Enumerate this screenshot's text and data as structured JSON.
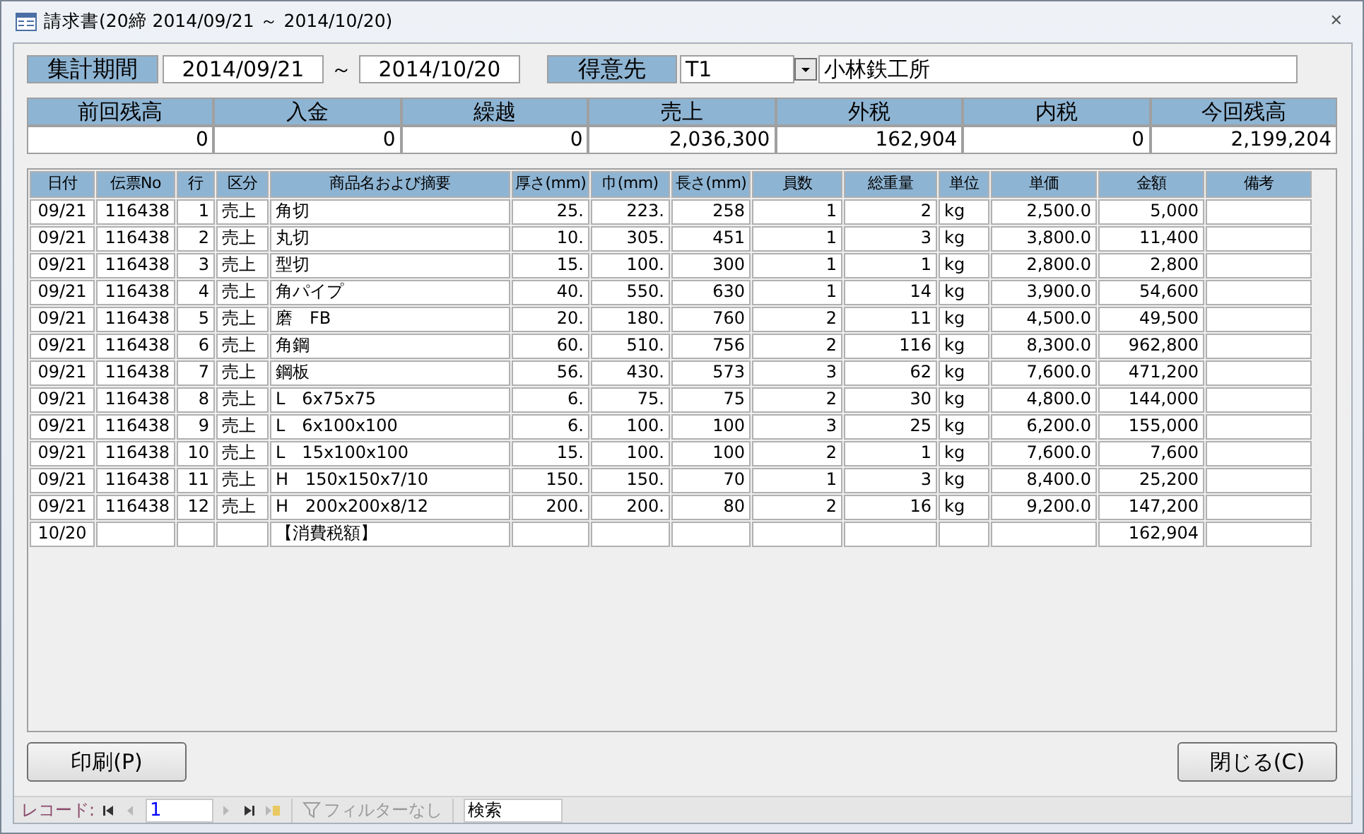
{
  "window": {
    "title": "請求書(20締 2014/09/21 ～ 2014/10/20)",
    "close": "✕"
  },
  "period": {
    "label": "集計期間",
    "from": "2014/09/21",
    "tilde": "～",
    "to": "2014/10/20"
  },
  "customer": {
    "label": "得意先",
    "code": "T1",
    "name": "小林鉄工所"
  },
  "summary": [
    {
      "label": "前回残高",
      "value": "0"
    },
    {
      "label": "入金",
      "value": "0"
    },
    {
      "label": "繰越",
      "value": "0"
    },
    {
      "label": "売上",
      "value": "2,036,300"
    },
    {
      "label": "外税",
      "value": "162,904"
    },
    {
      "label": "内税",
      "value": "0"
    },
    {
      "label": "今回残高",
      "value": "2,199,204"
    }
  ],
  "table": {
    "columns": [
      {
        "label": "日付",
        "kind": "text"
      },
      {
        "label": "伝票No",
        "kind": "number"
      },
      {
        "label": "行",
        "kind": "number"
      },
      {
        "label": "区分",
        "kind": "text"
      },
      {
        "label": "商品名および摘要",
        "kind": "text"
      },
      {
        "label": "厚さ(mm)",
        "kind": "number"
      },
      {
        "label": "巾(mm)",
        "kind": "number"
      },
      {
        "label": "長さ(mm)",
        "kind": "number"
      },
      {
        "label": "員数",
        "kind": "number"
      },
      {
        "label": "総重量",
        "kind": "number"
      },
      {
        "label": "単位",
        "kind": "text"
      },
      {
        "label": "単価",
        "kind": "number"
      },
      {
        "label": "金額",
        "kind": "number"
      },
      {
        "label": "備考",
        "kind": "text"
      }
    ],
    "rows": [
      [
        "09/21",
        "116438",
        "1",
        "売上",
        "角切",
        "25.",
        "223.",
        "258",
        "1",
        "2",
        "kg",
        "2,500.0",
        "5,000",
        null
      ],
      [
        "09/21",
        "116438",
        "2",
        "売上",
        "丸切",
        "10.",
        "305.",
        "451",
        "1",
        "3",
        "kg",
        "3,800.0",
        "11,400",
        null
      ],
      [
        "09/21",
        "116438",
        "3",
        "売上",
        "型切",
        "15.",
        "100.",
        "300",
        "1",
        "1",
        "kg",
        "2,800.0",
        "2,800",
        null
      ],
      [
        "09/21",
        "116438",
        "4",
        "売上",
        "角パイプ",
        "40.",
        "550.",
        "630",
        "1",
        "14",
        "kg",
        "3,900.0",
        "54,600",
        null
      ],
      [
        "09/21",
        "116438",
        "5",
        "売上",
        "磨　FB",
        "20.",
        "180.",
        "760",
        "2",
        "11",
        "kg",
        "4,500.0",
        "49,500",
        null
      ],
      [
        "09/21",
        "116438",
        "6",
        "売上",
        "角鋼",
        "60.",
        "510.",
        "756",
        "2",
        "116",
        "kg",
        "8,300.0",
        "962,800",
        null
      ],
      [
        "09/21",
        "116438",
        "7",
        "売上",
        "鋼板",
        "56.",
        "430.",
        "573",
        "3",
        "62",
        "kg",
        "7,600.0",
        "471,200",
        null
      ],
      [
        "09/21",
        "116438",
        "8",
        "売上",
        "L　6x75x75",
        "6.",
        "75.",
        "75",
        "2",
        "30",
        "kg",
        "4,800.0",
        "144,000",
        null
      ],
      [
        "09/21",
        "116438",
        "9",
        "売上",
        "L　6x100x100",
        "6.",
        "100.",
        "100",
        "3",
        "25",
        "kg",
        "6,200.0",
        "155,000",
        null
      ],
      [
        "09/21",
        "116438",
        "10",
        "売上",
        "L　15x100x100",
        "15.",
        "100.",
        "100",
        "2",
        "1",
        "kg",
        "7,600.0",
        "7,600",
        null
      ],
      [
        "09/21",
        "116438",
        "11",
        "売上",
        "H　150x150x7/10",
        "150.",
        "150.",
        "70",
        "1",
        "3",
        "kg",
        "8,400.0",
        "25,200",
        null
      ],
      [
        "09/21",
        "116438",
        "12",
        "売上",
        "H　200x200x8/12",
        "200.",
        "200.",
        "80",
        "2",
        "16",
        "kg",
        "9,200.0",
        "147,200",
        null
      ],
      [
        "10/20",
        null,
        null,
        null,
        "【消費税額】",
        null,
        null,
        null,
        null,
        null,
        null,
        null,
        "162,904",
        null
      ]
    ]
  },
  "buttons": [
    {
      "label": "印刷(P)",
      "kind": "left"
    },
    {
      "label": "閉じる(C)",
      "kind": "right"
    }
  ],
  "navigation": {
    "label": "レコード:",
    "record": "1",
    "nav_buttons": [
      {
        "kind": "first",
        "disabled": false
      },
      {
        "kind": "prev",
        "disabled": true
      },
      {
        "kind": "next",
        "disabled": true
      },
      {
        "kind": "last",
        "disabled": false
      },
      {
        "kind": "new",
        "disabled": true
      }
    ],
    "filter": {
      "label": "フィルターなし",
      "active": false
    },
    "search": "検索"
  }
}
